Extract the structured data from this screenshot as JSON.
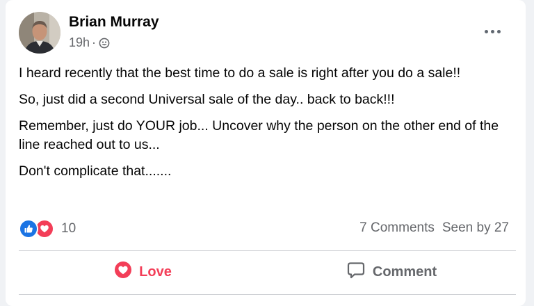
{
  "post": {
    "author": "Brian Murray",
    "time": "19h",
    "separator": "·",
    "audience_icon": "friends-icon",
    "menu_icon": "more-options-icon",
    "paragraphs": [
      "I heard recently that the best time to do a sale is right after you do a sale!!",
      "So, just did a second Universal sale of the day.. back to back!!!",
      "Remember, just do YOUR job... Uncover why the person on the other end of the line reached out to us...",
      "Don't complicate that......."
    ]
  },
  "reactions": {
    "count": "10",
    "types": [
      "like-icon",
      "love-icon"
    ]
  },
  "stats": {
    "comments": "7 Comments",
    "seen": "Seen by 27"
  },
  "actions": {
    "love_label": "Love",
    "comment_label": "Comment"
  },
  "colors": {
    "love": "#f33e58",
    "like": "#1b74e4",
    "secondary_text": "#65676b"
  }
}
